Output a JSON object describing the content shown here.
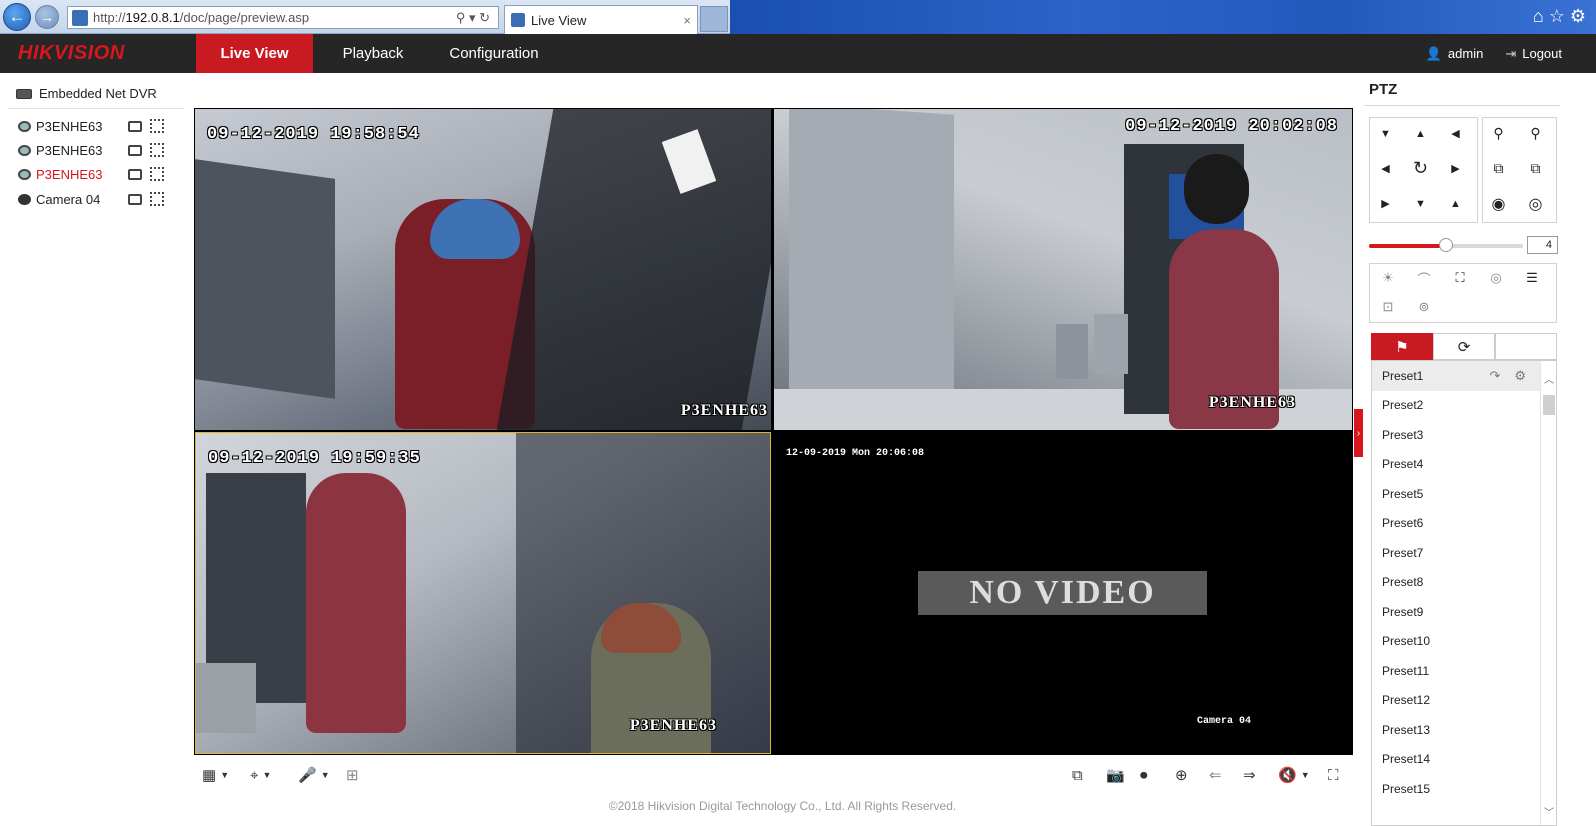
{
  "browser": {
    "url_prefix": "http://",
    "url_host": "192.0.8.1",
    "url_path": "/doc/page/preview.asp",
    "url_controls": "⚲ ▾ ↻",
    "tab_title": "Live View",
    "tab_close": "×",
    "back_glyph": "←",
    "forward_glyph": "→",
    "tools": "⌂ ☆ ⚙"
  },
  "app": {
    "brand": "HIKVISION",
    "nav": {
      "live": "Live View",
      "playback": "Playback",
      "config": "Configuration"
    },
    "user": "admin",
    "logout": "Logout",
    "user_icon": "👤",
    "logout_icon": "⇥"
  },
  "sidebar": {
    "device": "Embedded Net DVR",
    "cameras": [
      {
        "name": "P3ENHE63",
        "active": false
      },
      {
        "name": "P3ENHE63",
        "active": false
      },
      {
        "name": "P3ENHE63",
        "active": true
      },
      {
        "name": "Camera 04",
        "active": false
      }
    ]
  },
  "views": [
    {
      "timestamp": "09-12-2019 19:58:54",
      "label": "P3ENHE63"
    },
    {
      "timestamp": "09-12-2019 20:02:08",
      "label": "P3ENHE63"
    },
    {
      "timestamp": "09-12-2019 19:59:35",
      "label": "P3ENHE63"
    },
    {
      "timestamp": "12-09-2019 Mon 20:06:08",
      "label": "Camera 04",
      "no_video": "NO VIDEO"
    }
  ],
  "toolbar": {
    "layout": "▦",
    "ptz": "⌖",
    "mic": "🎤",
    "fisheye": "⊞",
    "stop_all": "⧉",
    "capture": "📷",
    "record": "⏺",
    "zoom": "⊕",
    "prev": "⇐",
    "next": "⇒",
    "volume": "🔇",
    "fullscreen": "⛶"
  },
  "footer": "©2018 Hikvision Digital Technology Co., Ltd. All Rights Reserved.",
  "ptz": {
    "title": "PTZ",
    "speed": "4",
    "speed_fraction": 0.5,
    "presets": [
      "Preset1",
      "Preset2",
      "Preset3",
      "Preset4",
      "Preset5",
      "Preset6",
      "Preset7",
      "Preset8",
      "Preset9",
      "Preset10",
      "Preset11",
      "Preset12",
      "Preset13",
      "Preset14",
      "Preset15"
    ],
    "preset_call_icon": "↷",
    "preset_set_icon": "⚙",
    "tab_preset_icon": "⚑",
    "tab_patrol_icon": "⟳"
  },
  "colors": {
    "accent": "#c91a21",
    "brand": "#d7161e",
    "appbar": "#262626"
  }
}
